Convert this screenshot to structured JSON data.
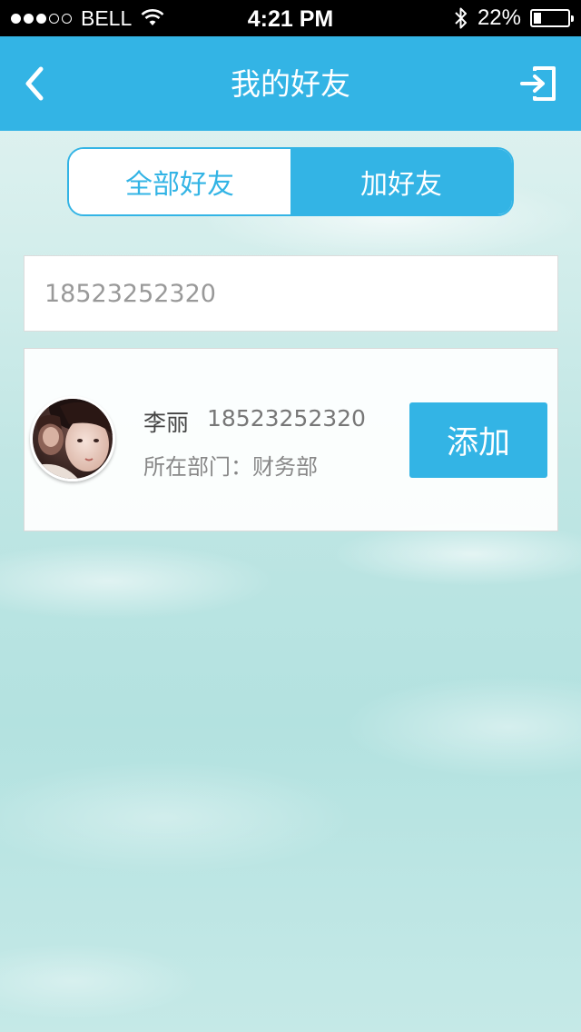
{
  "status_bar": {
    "carrier": "BELL",
    "time": "4:21 PM",
    "battery_percent": "22%",
    "battery_level": 0.22,
    "signal_bars_filled": 3,
    "signal_bars_total": 5
  },
  "nav": {
    "title": "我的好友",
    "back_icon": "chevron-left-icon",
    "exit_icon": "sign-out-icon"
  },
  "tabs": [
    {
      "label": "全部好友",
      "active": false
    },
    {
      "label": "加好友",
      "active": true
    }
  ],
  "search": {
    "value": "18523252320",
    "placeholder": ""
  },
  "result": {
    "name": "李丽",
    "phone": "18523252320",
    "department": "所在部门：财务部",
    "add_label": "添加"
  },
  "colors": {
    "accent": "#33b4e5",
    "status_bar": "#000000",
    "background": "#c8e9e7"
  }
}
